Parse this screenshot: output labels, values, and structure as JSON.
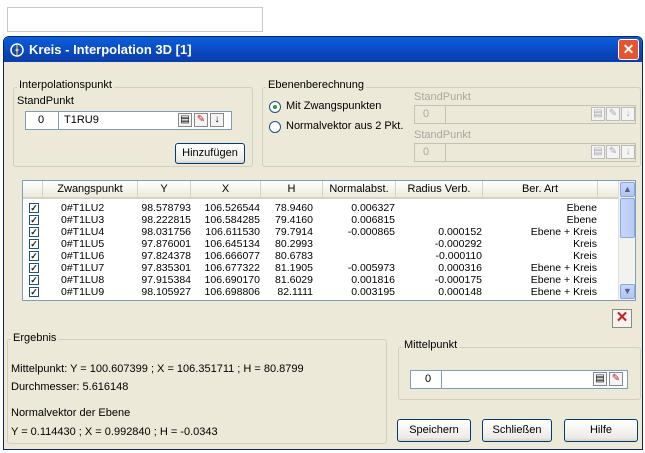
{
  "window": {
    "title": "Kreis - Interpolation 3D [1]"
  },
  "interp": {
    "legend": "Interpolationspunkt",
    "standpunkt_label": "StandPunkt",
    "number": "0",
    "point_name": "T1RU9",
    "add_button": "Hinzufügen"
  },
  "ebene": {
    "legend": "Ebenenberechnung",
    "radio1": "Mit Zwangspunkten",
    "radio2": "Normalvektor aus 2 Pkt.",
    "sp1_label": "StandPunkt",
    "sp1_number": "0",
    "sp2_label": "StandPunkt",
    "sp2_number": "0"
  },
  "table": {
    "headers": [
      "Zwangspunkt",
      "Y",
      "X",
      "H",
      "Normalabst.",
      "Radius Verb.",
      "Ber. Art"
    ],
    "rows": [
      {
        "name": "0#T1LU2",
        "y": "98.578793",
        "x": "106.526544",
        "h": "78.9460",
        "norm": "0.006327",
        "radius": "",
        "art": "Ebene"
      },
      {
        "name": "0#T1LU3",
        "y": "98.222815",
        "x": "106.584285",
        "h": "79.4160",
        "norm": "0.006815",
        "radius": "",
        "art": "Ebene"
      },
      {
        "name": "0#T1LU4",
        "y": "98.031756",
        "x": "106.611530",
        "h": "79.7914",
        "norm": "-0.000865",
        "radius": "0.000152",
        "art": "Ebene + Kreis"
      },
      {
        "name": "0#T1LU5",
        "y": "97.876001",
        "x": "106.645134",
        "h": "80.2993",
        "norm": "",
        "radius": "-0.000292",
        "art": "Kreis"
      },
      {
        "name": "0#T1LU6",
        "y": "97.824378",
        "x": "106.666077",
        "h": "80.6783",
        "norm": "",
        "radius": "-0.000110",
        "art": "Kreis"
      },
      {
        "name": "0#T1LU7",
        "y": "97.835301",
        "x": "106.677322",
        "h": "81.1905",
        "norm": "-0.005973",
        "radius": "0.000316",
        "art": "Ebene + Kreis"
      },
      {
        "name": "0#T1LU8",
        "y": "97.915384",
        "x": "106.690170",
        "h": "81.6029",
        "norm": "0.001816",
        "radius": "-0.000175",
        "art": "Ebene + Kreis"
      },
      {
        "name": "0#T1LU9",
        "y": "98.105927",
        "x": "106.698806",
        "h": "82.1111",
        "norm": "0.003195",
        "radius": "0.000148",
        "art": "Ebene + Kreis"
      }
    ]
  },
  "ergebnis": {
    "legend": "Ergebnis",
    "mittelpunkt": "Mittelpunkt:   Y = 100.607399 ; X = 106.351711 ; H = 80.8799",
    "durchmesser": "Durchmesser:  5.616148",
    "normal_label": "Normalvektor der Ebene",
    "normal_value": "Y = 0.114430 ; X = 0.992840 ; H = -0.0343"
  },
  "mittelpunkt_group": {
    "legend": "Mittelpunkt",
    "number": "0"
  },
  "buttons": {
    "save": "Speichern",
    "close": "Schließen",
    "help": "Hilfe"
  },
  "icons": [
    "app-icon",
    "close-icon",
    "notebook-icon",
    "pick-icon",
    "down-arrow-icon",
    "delete-icon",
    "scroll-up-icon",
    "scroll-down-icon"
  ]
}
